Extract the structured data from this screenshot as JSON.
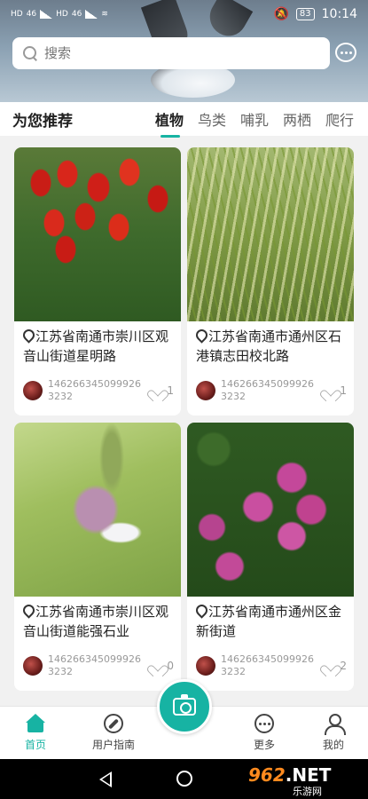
{
  "status_bar": {
    "left_labels": [
      "HD",
      "46",
      "HD",
      "46"
    ],
    "battery": "83",
    "time": "10:14"
  },
  "search": {
    "placeholder": "搜索"
  },
  "section": {
    "title": "为您推荐"
  },
  "tabs": [
    {
      "label": "植物",
      "active": true
    },
    {
      "label": "鸟类",
      "active": false
    },
    {
      "label": "哺乳",
      "active": false
    },
    {
      "label": "两栖",
      "active": false
    },
    {
      "label": "爬行",
      "active": false
    }
  ],
  "cards": [
    {
      "photo": "red-tulips",
      "location": "江苏省南通市崇川区观音山街道星明路",
      "user": "1462663450999263232",
      "likes": "1"
    },
    {
      "photo": "variegated-grass",
      "location": "江苏省南通市通州区石港镇志田校北路",
      "user": "1462663450999263232",
      "likes": "1"
    },
    {
      "photo": "pea-flower",
      "location": "江苏省南通市崇川区观音山街道能强石业",
      "user": "1462663450999263232",
      "likes": "0"
    },
    {
      "photo": "pink-oxalis",
      "location": "江苏省南通市通州区金新街道",
      "user": "1462663450999263232",
      "likes": "2"
    }
  ],
  "bottom_nav": {
    "home": "首页",
    "guide": "用户指南",
    "more": "更多",
    "mine": "我的"
  },
  "watermark": {
    "num": "962",
    "dom": ".NET",
    "sub": "乐游网"
  },
  "colors": {
    "accent": "#17b3a3"
  }
}
